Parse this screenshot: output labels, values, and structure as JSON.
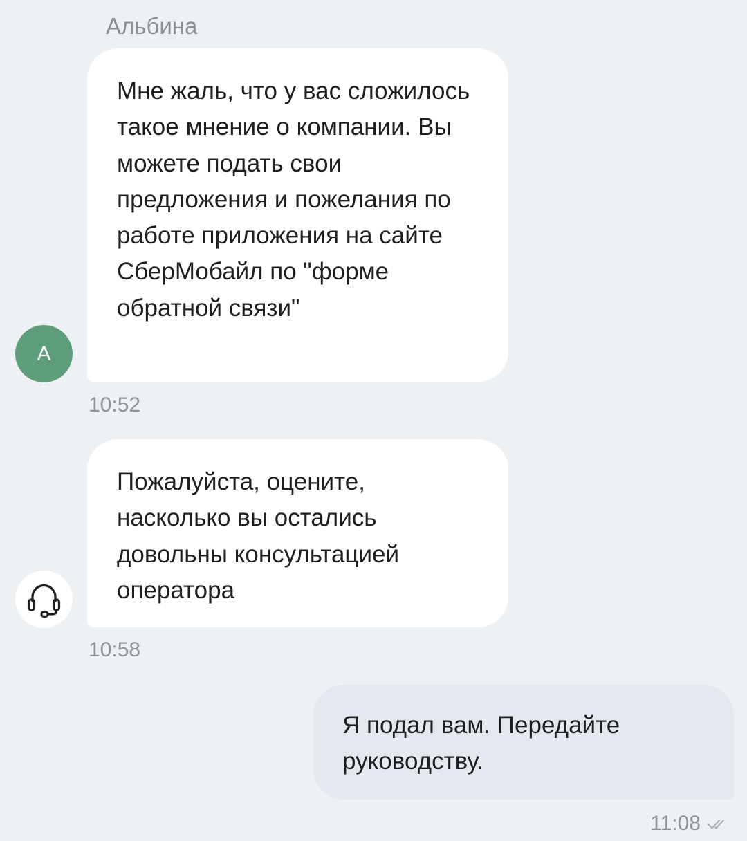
{
  "chat": {
    "sender_name": "Альбина",
    "messages": [
      {
        "direction": "incoming",
        "avatar_letter": "А",
        "text": "Мне жаль, что у вас сложилось такое мнение о компании. Вы можете подать свои предложения и пожелания по работе приложения на сайте СберМобайл по \"форме обратной связи\"",
        "time": "10:52"
      },
      {
        "direction": "incoming",
        "avatar_icon": "headset-icon",
        "text": "Пожалуйста, оцените, насколько вы остались довольны консультацией оператора",
        "time": "10:58"
      },
      {
        "direction": "outgoing",
        "text": "Я подал вам. Передайте руководству.",
        "time": "11:08",
        "status_icon": "double-check-icon"
      }
    ]
  },
  "colors": {
    "background": "#eef1f4",
    "incoming_bubble": "#ffffff",
    "outgoing_bubble": "#e3e9ee",
    "avatar_green": "#5e9e7b",
    "secondary_text": "#8f9499"
  }
}
